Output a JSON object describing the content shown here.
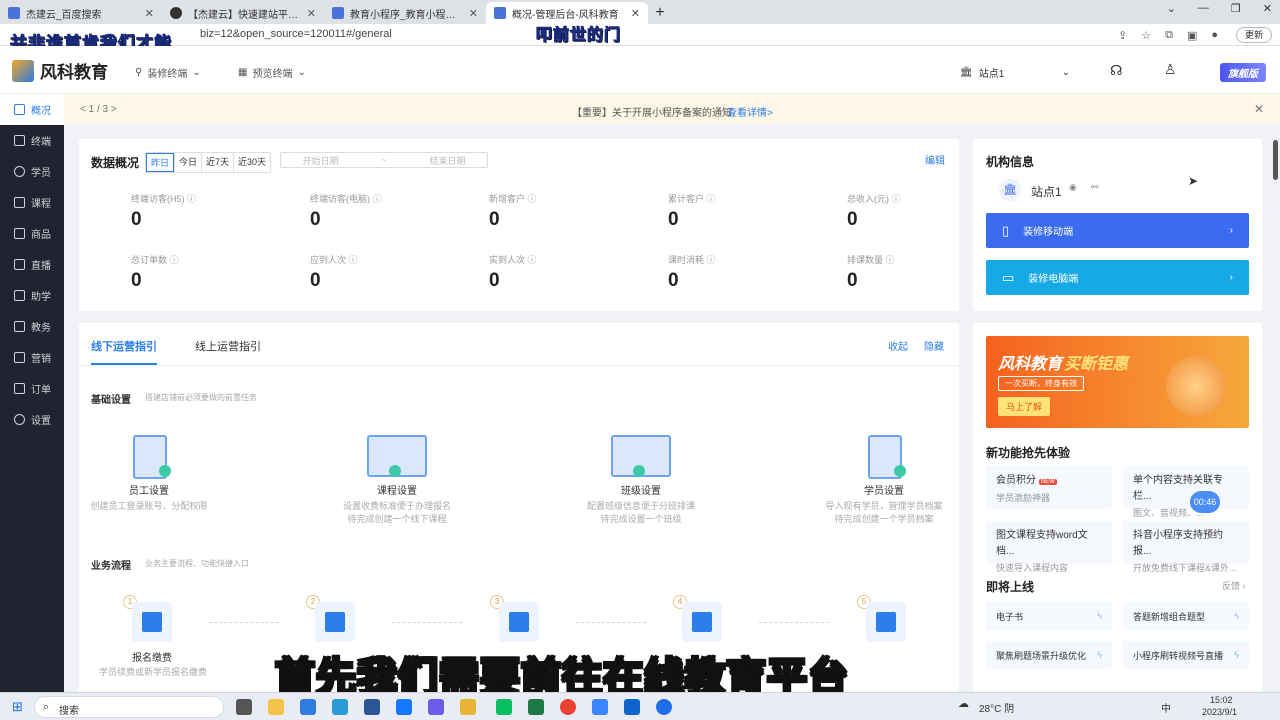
{
  "browser": {
    "tabs": [
      {
        "title": "杰建云_百度搜索",
        "active": false
      },
      {
        "title": "【杰建云】快速建站平台_在线...",
        "active": false
      },
      {
        "title": "教育小程序_教育小程序开发-风...",
        "active": false
      },
      {
        "title": "概况-管理后台-风科教育",
        "active": true
      }
    ],
    "url": "biz=12&open_source=120011#/general",
    "update_label": "更新"
  },
  "overlays": {
    "top_caption": "并非谁首肯我们才能",
    "center_caption": "叩前世的门",
    "subtitle": "首先我们需要前往在线教育平台"
  },
  "header": {
    "brand": "风科教育",
    "menu": [
      "装修终端",
      "预览终端"
    ],
    "site": "站点1",
    "flagship": "旗舰版"
  },
  "sidebar": {
    "items": [
      {
        "label": "概况",
        "active": true
      },
      {
        "label": "终端",
        "active": false
      },
      {
        "label": "学员",
        "active": false
      },
      {
        "label": "课程",
        "active": false
      },
      {
        "label": "商品",
        "active": false
      },
      {
        "label": "直播",
        "active": false
      },
      {
        "label": "助学",
        "active": false
      },
      {
        "label": "教务",
        "active": false
      },
      {
        "label": "营销",
        "active": false
      },
      {
        "label": "订单",
        "active": false
      },
      {
        "label": "设置",
        "active": false
      }
    ]
  },
  "notice": {
    "pager": "< 1 / 3 >",
    "text": "【重要】关于开展小程序备案的通知.",
    "link": "查看详情>"
  },
  "overview": {
    "title": "数据概况",
    "ranges": [
      "昨日",
      "今日",
      "近7天",
      "近30天"
    ],
    "start_placeholder": "开始日期",
    "sep": "~",
    "end_placeholder": "结束日期",
    "edit": "编辑",
    "stats": [
      {
        "label": "终端访客(H5)",
        "value": "0"
      },
      {
        "label": "终端访客(电脑)",
        "value": "0"
      },
      {
        "label": "新增客户",
        "value": "0"
      },
      {
        "label": "累计客户",
        "value": "0"
      },
      {
        "label": "总收入(元)",
        "value": "0"
      },
      {
        "label": "总订单数",
        "value": "0"
      },
      {
        "label": "应到人次",
        "value": "0"
      },
      {
        "label": "实到人次",
        "value": "0"
      },
      {
        "label": "课时消耗",
        "value": "0"
      },
      {
        "label": "排课数量",
        "value": "0"
      }
    ]
  },
  "guide": {
    "tabs": [
      "线下运营指引",
      "线上运营指引"
    ],
    "collapse": "收起",
    "hide": "隐藏",
    "basic_title": "基础设置",
    "basic_desc": "搭建店铺前必须要做的前置任务",
    "settings": [
      {
        "name": "员工设置",
        "desc1": "创建员工登录账号、分配权限",
        "desc2": ""
      },
      {
        "name": "课程设置",
        "desc1": "设置收费标准便于办理报名",
        "desc2": "待完成创建一个线下课程"
      },
      {
        "name": "班级设置",
        "desc1": "配置班级信息便于分班排课",
        "desc2": "待完成设置一个班级"
      },
      {
        "name": "学员设置",
        "desc1": "导入现有学员，管理学员档案",
        "desc2": "待完成创建一个学员档案"
      }
    ],
    "flow_title": "业务流程",
    "flow_desc": "业务主要流程、功能快捷入口",
    "flow": [
      {
        "num": "1",
        "name": "报名缴费",
        "desc": "学员续费或新学员报名缴费"
      },
      {
        "num": "2",
        "name": "",
        "desc": ""
      },
      {
        "num": "3",
        "name": "",
        "desc": ""
      },
      {
        "num": "4",
        "name": "",
        "desc": ""
      },
      {
        "num": "5",
        "name": "",
        "desc": ""
      }
    ]
  },
  "org": {
    "title": "机构信息",
    "site": "站点1",
    "btn_mobile": "装修移动端",
    "btn_pc": "装修电脑端"
  },
  "banner": {
    "title": "风科教育",
    "title_hl": "买断钜惠",
    "tag": "一次买断，终身有效",
    "btn": "马上了解"
  },
  "features": {
    "title": "新功能抢先体验",
    "items": [
      {
        "name": "会员积分",
        "badge": "NEW",
        "sub": "学员激励神器"
      },
      {
        "name": "单个内容支持关联专栏...",
        "badge": "",
        "sub": "图文、音视频、..."
      },
      {
        "name": "图文课程支持word文档...",
        "badge": "",
        "sub": "快速导入课程内容"
      },
      {
        "name": "抖音小程序支持预约报...",
        "badge": "",
        "sub": "开放免费线下课程&课外..."
      }
    ],
    "bubble": "00:46"
  },
  "coming": {
    "title": "即将上线",
    "feedback": "反馈 ›",
    "items": [
      "电子书",
      "答题新增组合题型",
      "聚焦刷题场景升级优化",
      "小程序刷转视频号直播"
    ]
  },
  "taskbar": {
    "search": "搜索",
    "weather": "28°C 阴",
    "ime": "中",
    "time": "15:02",
    "date": "2023/9/1"
  },
  "colors": {
    "accent": "#2b7de9",
    "sidebar_bg": "#1f2430",
    "btn_mobile": "#3b6cf0",
    "btn_pc": "#17a9e6",
    "banner": "#f47a26"
  }
}
